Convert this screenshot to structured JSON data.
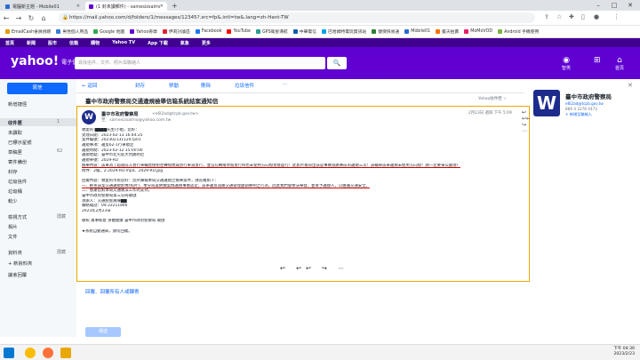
{
  "browser": {
    "tabs": [
      {
        "label": "電腦新主題 - Mobile01",
        "color": "#2a6cd1"
      },
      {
        "label": "(1 封未讀郵件) - samesizsalmo",
        "color": "#6001d2"
      }
    ],
    "new_tab": "+",
    "url": "https://mail.yahoo.com/d/folders/1/messages/12345?.src=fp&.intl=tw&.lang=zh-Hant-TW",
    "controls": {
      "minimize": "–",
      "maximize": "□",
      "close": "✕"
    }
  },
  "bookmarks": [
    {
      "label": "EmailCash會員捐贈",
      "color": "#e59a00"
    },
    {
      "label": "男性個人用品",
      "color": "#3a7bd5"
    },
    {
      "label": "Google 地圖",
      "color": "#34a853"
    },
    {
      "label": "Yahoo奇摩",
      "color": "#6001d2"
    },
    {
      "label": "伊莉討論區",
      "color": "#d23"
    },
    {
      "label": "Facebook",
      "color": "#1877f2"
    },
    {
      "label": "YouTube",
      "color": "#f00"
    },
    {
      "label": "GPS衛星導航",
      "color": "#2a9d8f"
    },
    {
      "label": "中華電信",
      "color": "#0b5cad"
    },
    {
      "label": "巴哈姆特電玩資訊站",
      "color": "#00a0e9"
    },
    {
      "label": "健保快易通",
      "color": "#2e7d32"
    },
    {
      "label": "Mobile01",
      "color": "#2a6cd1"
    },
    {
      "label": "露天拍賣",
      "color": "#ff6f00"
    },
    {
      "label": "MoMoVOD",
      "color": "#e91e63"
    },
    {
      "label": "Android 手機使用",
      "color": "#7cb342"
    }
  ],
  "yahoo_nav": [
    "首頁",
    "新聞",
    "股市",
    "信箱",
    "購物",
    "Yahoo TV",
    "App 下載",
    "氣象",
    "更多"
  ],
  "header": {
    "logo": "yahoo!",
    "logo_sub": "電子信箱",
    "search_placeholder": "尋找信件、文件、照片與聯絡人",
    "search_adv": "進階",
    "search_icon": "🔍",
    "account": "智男",
    "home": "首頁"
  },
  "left": {
    "compose": "寫信",
    "folders": [
      {
        "label": "新增捷徑",
        "count": ""
      },
      {
        "label": "收件匣",
        "count": "1"
      },
      {
        "label": "未讀取",
        "count": ""
      },
      {
        "label": "已標示星號",
        "count": ""
      },
      {
        "label": "草稿匣",
        "count": "62"
      },
      {
        "label": "寄件備份",
        "count": ""
      },
      {
        "label": "封存",
        "count": ""
      },
      {
        "label": "垃圾信件",
        "count": ""
      },
      {
        "label": "垃圾桶",
        "count": ""
      },
      {
        "label": "較少",
        "count": ""
      },
      {
        "label": "檢視方式",
        "count": "隱藏"
      },
      {
        "label": "相片",
        "count": ""
      },
      {
        "label": "文件",
        "count": ""
      },
      {
        "label": "資料夾",
        "count": "隱藏"
      },
      {
        "label": "+ 新資料夾",
        "count": ""
      },
      {
        "label": "議會回覆",
        "count": ""
      }
    ]
  },
  "toolbar": [
    "← 返回",
    "封存",
    "移動",
    "刪除",
    "垃圾信件",
    "⋯"
  ],
  "mail": {
    "subject": "臺中市政府警察局交通違規檢舉信箱系統結案通知信",
    "list_date": "Yahoo收件匣 ☆",
    "sender": "臺中市政府警察局",
    "sender_email": "<e6l2ad@tcpb.gov.tw>",
    "to": "至：samesizsalmo@yahoo.com.tw",
    "date": "2月23日 週四 下午 5:09",
    "lines": [
      "親愛的 ████先生/小姐，您好：",
      "受理日期：2023-02-13 16:44:25",
      "案件編號：2023021311247p01",
      "違規事項：違反62-1行車規定",
      "違規時間：2023-02-12 15:00:00",
      "違規地點：臺中市北屯區大坑路附近",
      "違規車號：2029-RU",
      "檢舉內容：該車為了超越前方直行車輛直接把左轉燈熄滅直行車道直行，並沒在轉角停留直行時也未使用方向燈直接超行！此影片看得出該是事故道路事前的違規三次！該輛車該車違規未使用方向燈！請一定要秉公處理！",
      "附件：2檔，2-2029-RU.mp4、2029-RU.jpg",
      "",
      "回覆內容：親愛的市民您好：您所陳報本局交通違規之檢舉案件，謹答覆如下：",
      "一、經查該案交通違規影像(照片)，本分局業依據案情違規事實認定，該車違反道路交通管理處罰條例之行為，因此我們會依法舉發，並寄予違規人，以維護交通安全。",
      "二、感謝您對本局交通執法工作的支持。",
      "臺中市政府警察局第三分局敬啟",
      "承辦人：交通組警員陳██",
      "聯絡電話：04-22211846",
      "2023年2月23日",
      "",
      "敬祝 萬事如意 身體健康 臺中市政府警察局 敬啟",
      "",
      "★系統自動通知，請勿回覆。"
    ],
    "bottom_actions": "↩ ↩↩ ↪ ⋯",
    "reply_link": "回覆、回覆所有人或轉寄",
    "send": "傳送"
  },
  "right_panel": {
    "avatar": "W",
    "name": "臺中市政府警察局",
    "email": "e6l2ad@tcpb.gov.tw",
    "phone": "886 4 2278 4473",
    "add": "+ 新增至聯絡人"
  },
  "taskbar": {
    "time": "下午 04:36",
    "date": "2023/2/23"
  }
}
